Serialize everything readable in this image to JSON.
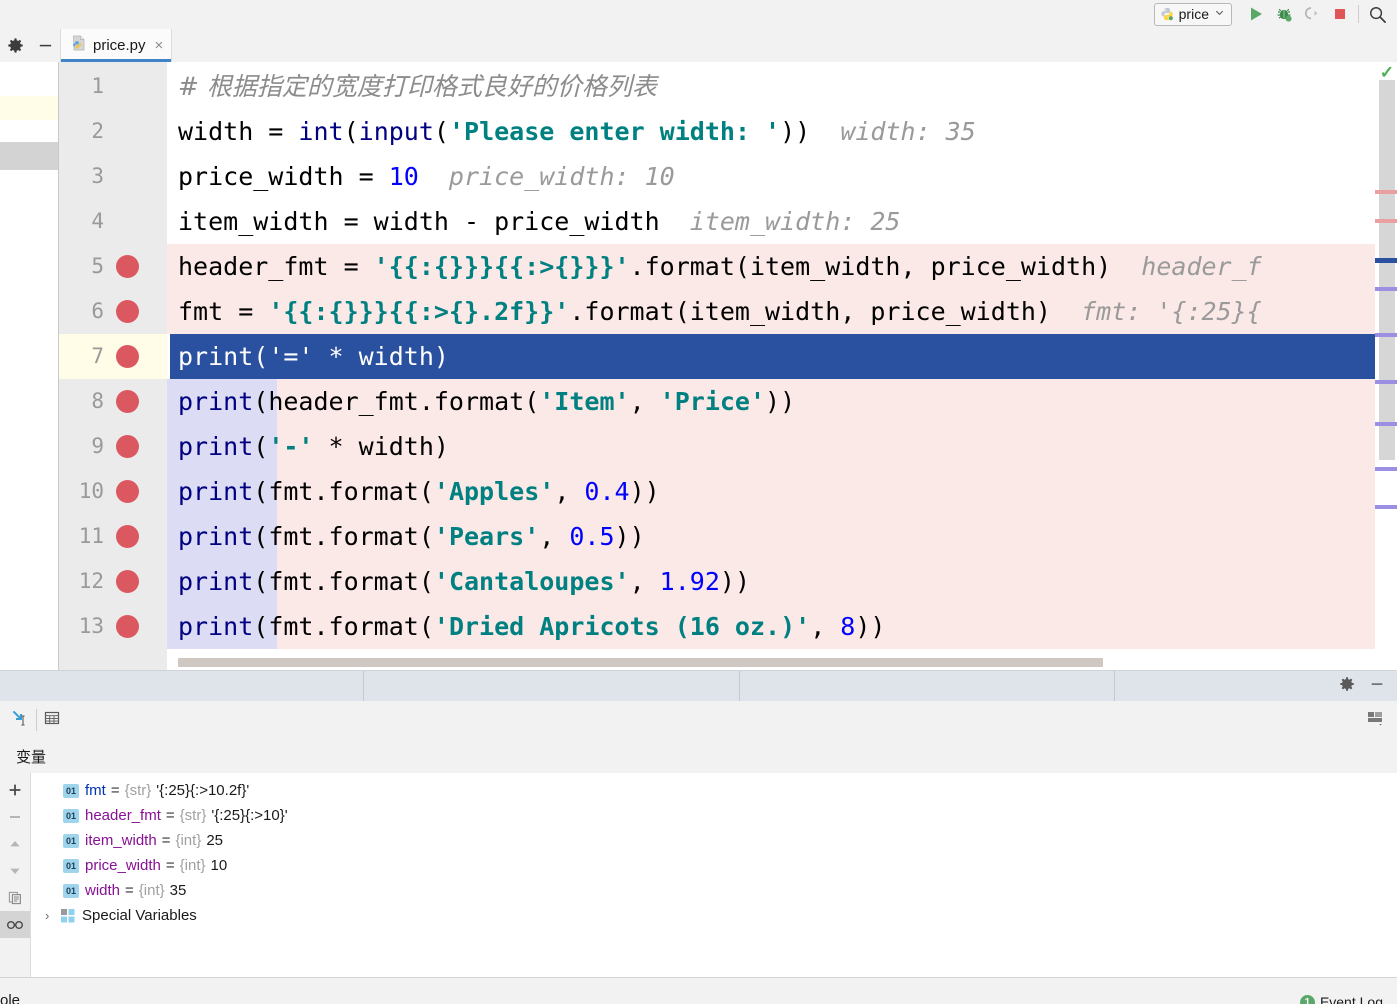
{
  "toolbar": {
    "run_config_label": "price",
    "run_config_icon": "python-icon",
    "dropdown_icon": "chevron-down-icon",
    "buttons": [
      {
        "name": "run-button",
        "icon": "play-triangle-icon"
      },
      {
        "name": "debug-button",
        "icon": "bug-icon"
      },
      {
        "name": "coverage-button",
        "icon": "run-coverage-icon"
      },
      {
        "name": "stop-button",
        "icon": "stop-square-icon"
      },
      {
        "name": "search-everywhere-button",
        "icon": "magnifier-icon"
      }
    ]
  },
  "tabbar": {
    "settings_icon": "gear-icon",
    "minimize_icon": "minus-icon",
    "tab": {
      "file_icon": "python-file-icon",
      "name": "price.py",
      "close": "×"
    }
  },
  "editor": {
    "inspection_status_icon": "green-check-icon",
    "lines": [
      {
        "num": "1",
        "breakpoint": false,
        "executing": false,
        "tokens": [
          {
            "t": "# 根据指定的宽度打印格式良好的价格列表",
            "c": "k-comment"
          }
        ]
      },
      {
        "num": "2",
        "breakpoint": false,
        "executing": false,
        "tokens": [
          {
            "t": "width = ",
            "c": "k-plain"
          },
          {
            "t": "int",
            "c": "k-fn"
          },
          {
            "t": "(",
            "c": "k-plain"
          },
          {
            "t": "input",
            "c": "k-fn"
          },
          {
            "t": "(",
            "c": "k-plain"
          },
          {
            "t": "'Please enter width: '",
            "c": "k-str"
          },
          {
            "t": "))",
            "c": "k-plain"
          },
          {
            "t": "  width: 35",
            "c": "k-hint"
          }
        ]
      },
      {
        "num": "3",
        "breakpoint": false,
        "executing": false,
        "tokens": [
          {
            "t": "price_width = ",
            "c": "k-plain"
          },
          {
            "t": "10",
            "c": "k-num"
          },
          {
            "t": "  price_width: 10",
            "c": "k-hint"
          }
        ]
      },
      {
        "num": "4",
        "breakpoint": false,
        "executing": false,
        "tokens": [
          {
            "t": "item_width = width - price_width",
            "c": "k-plain"
          },
          {
            "t": "  item_width: 25",
            "c": "k-hint"
          }
        ]
      },
      {
        "num": "5",
        "breakpoint": true,
        "executing": false,
        "tokens": [
          {
            "t": "header_fmt = ",
            "c": "k-plain"
          },
          {
            "t": "'{{:{}}}{{:>{}}}'",
            "c": "k-str"
          },
          {
            "t": ".format(item_width, price_width)",
            "c": "k-plain"
          },
          {
            "t": "  header_f",
            "c": "k-hint"
          }
        ]
      },
      {
        "num": "6",
        "breakpoint": true,
        "executing": false,
        "tokens": [
          {
            "t": "fmt = ",
            "c": "k-plain"
          },
          {
            "t": "'{{:{}}}{{:>{}.2f}}'",
            "c": "k-str"
          },
          {
            "t": ".format(item_width, price_width)",
            "c": "k-plain"
          },
          {
            "t": "  fmt: '{:25}{",
            "c": "k-hint"
          }
        ]
      },
      {
        "num": "7",
        "breakpoint": true,
        "executing": true,
        "tokens": [
          {
            "t": "print(",
            "c": "k-white"
          },
          {
            "t": "'='",
            "c": "k-white"
          },
          {
            "t": " * width)",
            "c": "k-white"
          }
        ]
      },
      {
        "num": "8",
        "breakpoint": true,
        "executing": false,
        "tokens": [
          {
            "t": "print",
            "c": "k-fn"
          },
          {
            "t": "(header_fmt.format(",
            "c": "k-plain"
          },
          {
            "t": "'Item'",
            "c": "k-str"
          },
          {
            "t": ", ",
            "c": "k-plain"
          },
          {
            "t": "'Price'",
            "c": "k-str"
          },
          {
            "t": "))",
            "c": "k-plain"
          }
        ]
      },
      {
        "num": "9",
        "breakpoint": true,
        "executing": false,
        "tokens": [
          {
            "t": "print",
            "c": "k-fn"
          },
          {
            "t": "(",
            "c": "k-plain"
          },
          {
            "t": "'-'",
            "c": "k-str"
          },
          {
            "t": " * width)",
            "c": "k-plain"
          }
        ]
      },
      {
        "num": "10",
        "breakpoint": true,
        "executing": false,
        "tokens": [
          {
            "t": "print",
            "c": "k-fn"
          },
          {
            "t": "(fmt.format(",
            "c": "k-plain"
          },
          {
            "t": "'Apples'",
            "c": "k-str"
          },
          {
            "t": ", ",
            "c": "k-plain"
          },
          {
            "t": "0.4",
            "c": "k-num"
          },
          {
            "t": "))",
            "c": "k-plain"
          }
        ]
      },
      {
        "num": "11",
        "breakpoint": true,
        "executing": false,
        "tokens": [
          {
            "t": "print",
            "c": "k-fn"
          },
          {
            "t": "(fmt.format(",
            "c": "k-plain"
          },
          {
            "t": "'Pears'",
            "c": "k-str"
          },
          {
            "t": ", ",
            "c": "k-plain"
          },
          {
            "t": "0.5",
            "c": "k-num"
          },
          {
            "t": "))",
            "c": "k-plain"
          }
        ]
      },
      {
        "num": "12",
        "breakpoint": true,
        "executing": false,
        "tokens": [
          {
            "t": "print",
            "c": "k-fn"
          },
          {
            "t": "(fmt.format(",
            "c": "k-plain"
          },
          {
            "t": "'Cantaloupes'",
            "c": "k-str"
          },
          {
            "t": ", ",
            "c": "k-plain"
          },
          {
            "t": "1.92",
            "c": "k-num"
          },
          {
            "t": "))",
            "c": "k-plain"
          }
        ]
      },
      {
        "num": "13",
        "breakpoint": true,
        "executing": false,
        "tokens": [
          {
            "t": "print",
            "c": "k-fn"
          },
          {
            "t": "(fmt.format(",
            "c": "k-plain"
          },
          {
            "t": "'Dried Apricots (16 oz.)'",
            "c": "k-str"
          },
          {
            "t": ", ",
            "c": "k-plain"
          },
          {
            "t": "8",
            "c": "k-num"
          },
          {
            "t": "))",
            "c": "k-plain"
          }
        ]
      }
    ]
  },
  "divider_band": {
    "settings_icon": "gear-icon",
    "hide_icon": "minus-icon"
  },
  "debug_toolrow": {
    "buttons": [
      {
        "name": "evaluate-expression-button",
        "icon": "evaluate-icon"
      },
      {
        "name": "show-variables-button",
        "icon": "table-grid-icon"
      },
      {
        "name": "layout-settings-button",
        "icon": "layout-icon"
      }
    ]
  },
  "variables_panel": {
    "title": "变量",
    "side_buttons": [
      {
        "name": "add-watch-button",
        "icon": "plus-icon",
        "active": false
      },
      {
        "name": "remove-watch-button",
        "icon": "minus-icon",
        "active": false
      },
      {
        "name": "move-up-button",
        "icon": "triangle-up-icon",
        "active": false
      },
      {
        "name": "move-down-button",
        "icon": "triangle-down-icon",
        "active": false
      },
      {
        "name": "copy-button",
        "icon": "copy-icon",
        "active": false
      },
      {
        "name": "inspect-button",
        "icon": "glasses-icon",
        "active": true
      }
    ],
    "rows": [
      {
        "badge": "01",
        "name": "fmt",
        "name_color": "blue",
        "type": "{str}",
        "value": "'{:25}{:>10.2f}'"
      },
      {
        "badge": "01",
        "name": "header_fmt",
        "name_color": "purple",
        "type": "{str}",
        "value": "'{:25}{:>10}'"
      },
      {
        "badge": "01",
        "name": "item_width",
        "name_color": "purple",
        "type": "{int}",
        "value": "25"
      },
      {
        "badge": "01",
        "name": "price_width",
        "name_color": "purple",
        "type": "{int}",
        "value": "10"
      },
      {
        "badge": "01",
        "name": "width",
        "name_color": "purple",
        "type": "{int}",
        "value": "35"
      }
    ],
    "special_variables": {
      "chevron": "›",
      "icon": "group-squares-icon",
      "label": "Special Variables"
    }
  },
  "statusbar": {
    "console_tab": "ole",
    "event_log": {
      "count": "1",
      "label": "Event Log"
    }
  },
  "colors": {
    "breakpoint_red": "#db5860",
    "execution_line_blue": "#2a50a0",
    "breakpoint_row_bg": "#fbe9e7",
    "gutter_exec_bg": "#fffde8",
    "tab_underline": "#4083c9",
    "string_teal": "#008080",
    "keyword_navy": "#000080",
    "number_blue": "#0000ff",
    "accent_green": "#59a869"
  }
}
